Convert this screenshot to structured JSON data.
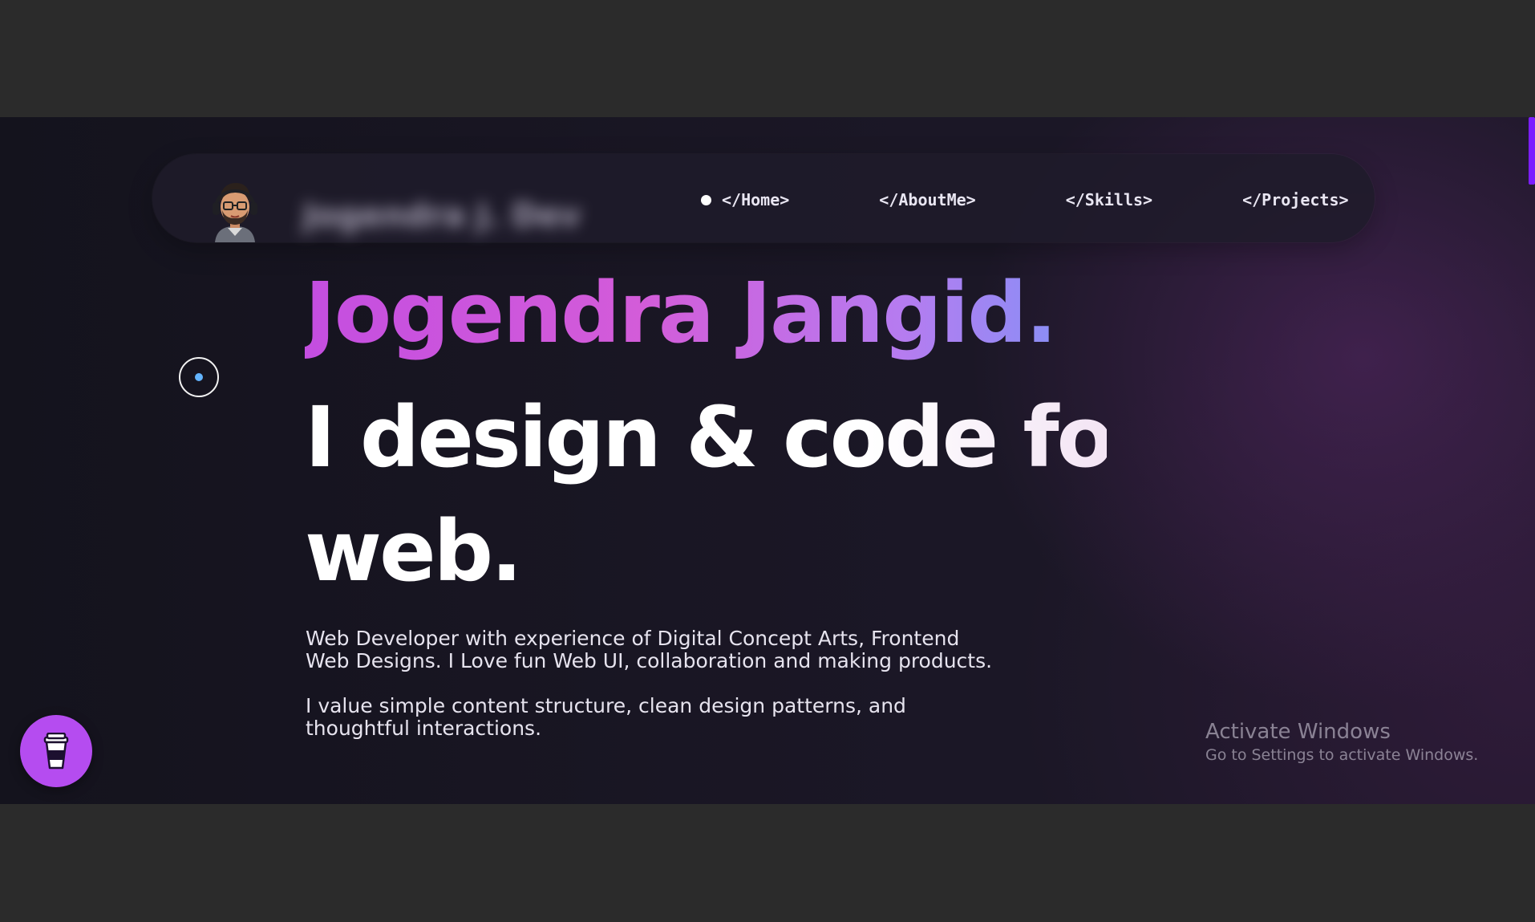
{
  "navbar": {
    "brand_blurred": "Jogendra J. Dev",
    "avatar_icon": "memoji-avatar-icon",
    "active_indicator_icon": "dot-icon",
    "links": [
      {
        "label": "</Home>"
      },
      {
        "label": "</AboutMe>"
      },
      {
        "label": "</Skills>"
      },
      {
        "label": "</Projects>"
      }
    ]
  },
  "hero": {
    "name": "Jogendra Jangid.",
    "tagline_line1": "I design & code for",
    "tagline_line2": "web.",
    "description_1": "Web Developer with experience of Digital Concept Arts, Frontend Web Designs. I Love fun Web UI, collaboration and making products.",
    "description_2": "I value simple content structure, clean design patterns, and thoughtful interactions."
  },
  "floating": {
    "coffee_icon": "coffee-cup-icon",
    "cursor_icon": "cursor-ring-icon"
  },
  "watermark": {
    "title": "Activate Windows",
    "subtitle": "Go to Settings to activate Windows."
  },
  "colors": {
    "background": "#1b1726",
    "accent_purple": "#b54cf0",
    "scroll_thumb": "#7c1dff",
    "name_gradient_start": "#c44ee0",
    "name_gradient_end": "#8b8ef5",
    "cursor_dot": "#63b4ff"
  }
}
